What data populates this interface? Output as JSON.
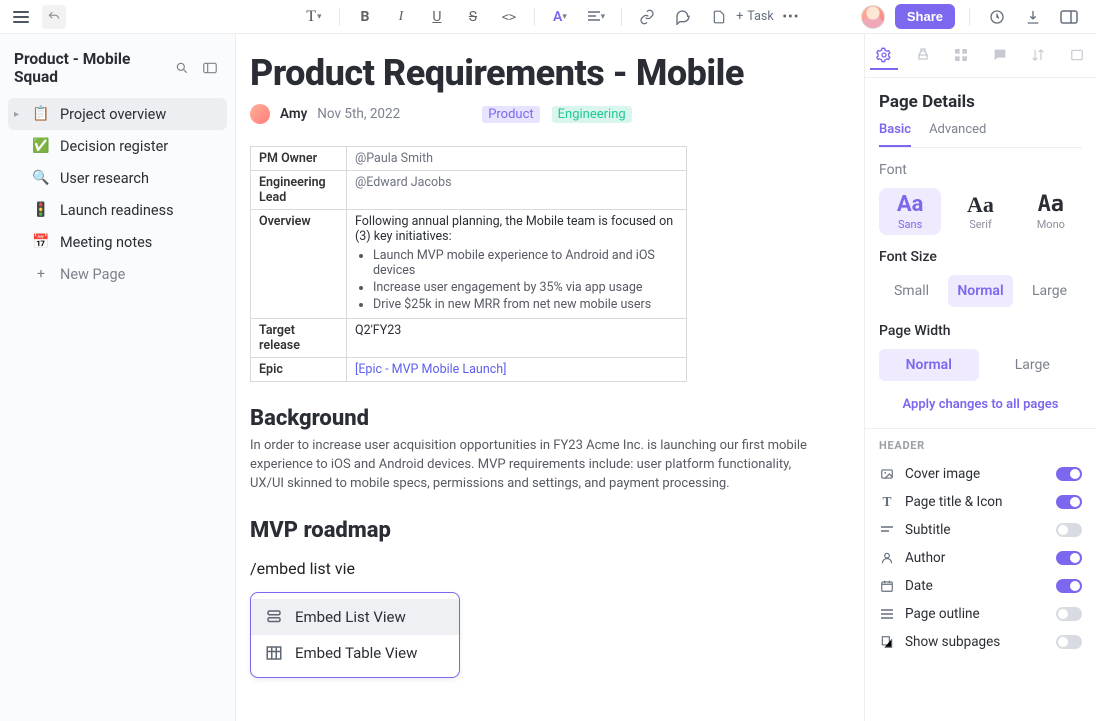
{
  "topbar": {
    "share_label": "Share",
    "task_label": "Task"
  },
  "sidebar": {
    "workspace_title": "Product - Mobile Squad",
    "items": [
      {
        "icon": "📋",
        "label": "Project overview",
        "selected": true,
        "caret": true
      },
      {
        "icon": "✅",
        "label": "Decision register"
      },
      {
        "icon": "🔍",
        "label": "User research"
      },
      {
        "icon": "🚦",
        "label": "Launch readiness"
      },
      {
        "icon": "📅",
        "label": "Meeting notes"
      }
    ],
    "new_page_label": "New Page"
  },
  "doc": {
    "title": "Product Requirements - Mobile",
    "author": "Amy",
    "date": "Nov 5th, 2022",
    "tags": {
      "product": "Product",
      "engineering": "Engineering"
    },
    "table": {
      "pm_owner_k": "PM Owner",
      "pm_owner_v": "@Paula Smith",
      "eng_lead_k": "Engineering Lead",
      "eng_lead_v": "@Edward Jacobs",
      "overview_k": "Overview",
      "overview_intro": "Following annual planning, the Mobile team is focused on (3) key initiatives:",
      "overview_bullets": [
        "Launch MVP mobile experience to Android and iOS devices",
        "Increase user engagement by 35% via app usage",
        "Drive $25k in new MRR from net new mobile users"
      ],
      "target_k": "Target release",
      "target_v": "Q2'FY23",
      "epic_k": "Epic",
      "epic_v": "[Epic - MVP Mobile Launch]"
    },
    "background_h": "Background",
    "background_body": "In order to increase user acquisition opportunities in FY23 Acme Inc. is launching our first mobile experience to iOS and Android devices. MVP requirements include: user platform functionality, UX/UI skinned to mobile specs, permissions and settings, and payment processing.",
    "roadmap_h": "MVP roadmap",
    "slash_input": "/embed list vie",
    "embed_options": [
      {
        "label": "Embed List View",
        "selected": true
      },
      {
        "label": "Embed Table View"
      }
    ]
  },
  "panel": {
    "title": "Page Details",
    "subtab_basic": "Basic",
    "subtab_adv": "Advanced",
    "font_label": "Font",
    "fonts": {
      "sans": "Sans",
      "serif": "Serif",
      "mono": "Mono"
    },
    "font_size_label": "Font Size",
    "sizes": {
      "small": "Small",
      "normal": "Normal",
      "large": "Large"
    },
    "width_label": "Page Width",
    "widths": {
      "normal": "Normal",
      "large": "Large"
    },
    "apply_all": "Apply changes to all pages",
    "header_label": "HEADER",
    "toggles": [
      {
        "label": "Cover image",
        "on": true,
        "icon": "image"
      },
      {
        "label": "Page title & Icon",
        "on": true,
        "icon": "title"
      },
      {
        "label": "Subtitle",
        "on": false,
        "icon": "subtitle"
      },
      {
        "label": "Author",
        "on": true,
        "icon": "author"
      },
      {
        "label": "Date",
        "on": true,
        "icon": "date"
      },
      {
        "label": "Page outline",
        "on": false,
        "icon": "outline"
      },
      {
        "label": "Show subpages",
        "on": false,
        "icon": "subpages"
      }
    ]
  }
}
